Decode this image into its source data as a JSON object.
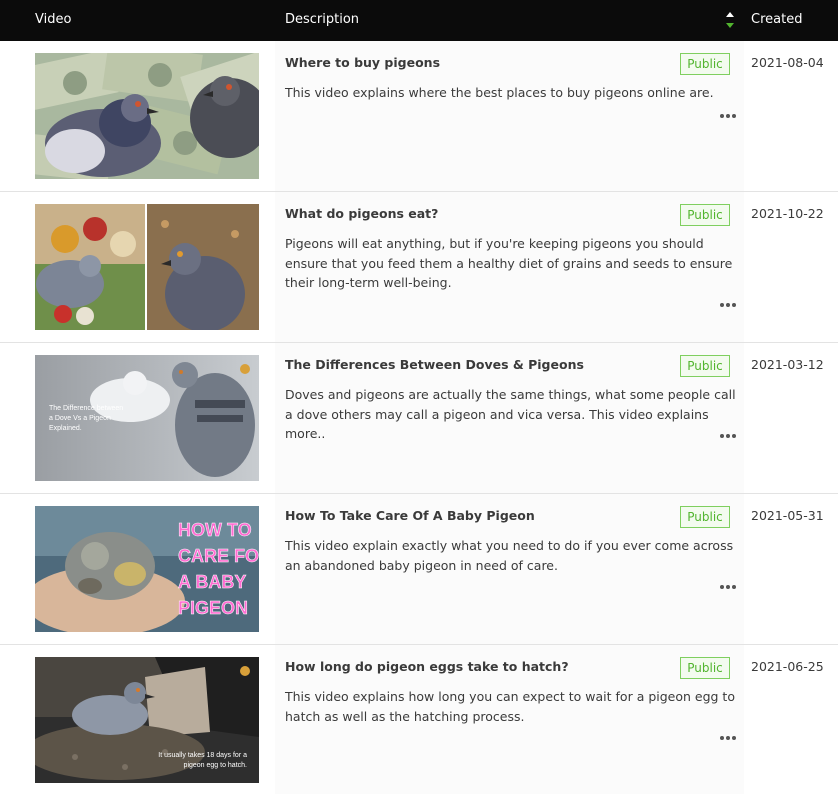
{
  "header": {
    "video_label": "Video",
    "description_label": "Description",
    "created_label": "Created",
    "sort_icon": "sort-icon"
  },
  "colors": {
    "header_bg": "#0b0b0b",
    "badge_green": "#52b52f",
    "sort_active": "#52b52f"
  },
  "videos": [
    {
      "title": "Where to buy pigeons",
      "status": "Public",
      "description": "This video explains where the best places to buy pigeons online are.",
      "created": "2021-08-04",
      "thumbnail_text": ""
    },
    {
      "title": "What do pigeons eat?",
      "status": "Public",
      "description": "Pigeons will eat anything, but if you're keeping pigeons you should ensure that you feed them a healthy diet of grains and seeds to ensure their long-term well-being.",
      "created": "2021-10-22",
      "thumbnail_text": ""
    },
    {
      "title": "The Differences Between Doves & Pigeons",
      "status": "Public",
      "description": "Doves and pigeons are actually the same things, what some people call a dove others may call a pigeon and vica versa. This video explains more..",
      "created": "2021-03-12",
      "thumbnail_text": "The Difference between a Dove Vs a Pigeon Explained."
    },
    {
      "title": "How To Take Care Of A Baby Pigeon",
      "status": "Public",
      "description": "This video explain exactly what you need to do if you ever come across an abandoned baby pigeon in need of care.",
      "created": "2021-05-31",
      "thumbnail_text": "HOW TO CARE FOR A BABY PIGEON"
    },
    {
      "title": "How long do pigeon eggs take to hatch?",
      "status": "Public",
      "description": "This video explains how long you can expect to wait for a pigeon egg to hatch as well as the hatching process.",
      "created": "2021-06-25",
      "thumbnail_text": "It usually takes 18 days for a pigeon egg to hatch."
    }
  ]
}
